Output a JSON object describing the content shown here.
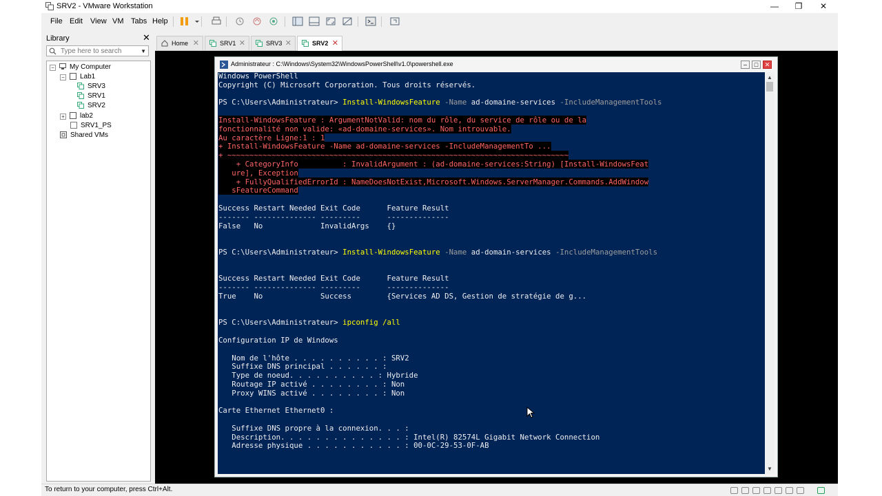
{
  "window": {
    "title": "SRV2 - VMware Workstation"
  },
  "menu": [
    "File",
    "Edit",
    "View",
    "VM",
    "Tabs",
    "Help"
  ],
  "library": {
    "header": "Library",
    "search_placeholder": "Type here to search",
    "tree": [
      "My Computer",
      "Lab1",
      "SRV3",
      "SRV1",
      "SRV2",
      "lab2",
      "SRV1_PS",
      "Shared VMs"
    ]
  },
  "tabs": [
    {
      "label": "Home"
    },
    {
      "label": "SRV1"
    },
    {
      "label": "SRV3"
    },
    {
      "label": "SRV2",
      "active": true
    }
  ],
  "powershell": {
    "title": "Administrateur : C:\\Windows\\System32\\WindowsPowerShell\\v1.0\\powershell.exe",
    "header": [
      "Windows PowerShell",
      "Copyright (C) Microsoft Corporation. Tous droits réservés."
    ],
    "prompt": "PS C:\\Users\\Administrateur>",
    "cmd1": {
      "name": "Install-WindowsFeature",
      "param": "-Name",
      "value": "ad-domaine-services",
      "switch": "-IncludeManagementTools"
    },
    "error_lines": [
      "Install-WindowsFeature : ArgumentNotValid: nom du rôle, du service de rôle ou de la",
      "fonctionnalité non valide: «ad-domaine-services». Nom introuvable.",
      "Au caractère Ligne:1 : 1",
      "+ Install-WindowsFeature -Name ad-domaine-services -IncludeManagementTo ...",
      "+ ~~~~~~~~~~~~~~~~~~~~~~~~~~~~~~~~~~~~~~~~~~~~~~~~~~~~~~~~~~~~~~~~~~~~~~~~~~~~~",
      "    + CategoryInfo          : InvalidArgument : (ad-domaine-services:String) [Install-WindowsFeat",
      "   ure], Exception",
      "    + FullyQualifiedErrorId : NameDoesNotExist,Microsoft.Windows.ServerManager.Commands.AddWindow",
      "   sFeatureCommand"
    ],
    "result_header": "Success Restart Needed Exit Code      Feature Result",
    "result_rule": "------- -------------- ---------      --------------",
    "result1": "False   No             InvalidArgs    {}",
    "cmd2": {
      "name": "Install-WindowsFeature",
      "param": "-Name",
      "value": "ad-domain-services",
      "switch": "-IncludeManagementTools"
    },
    "result2": "True    No             Success        {Services AD DS, Gestion de stratégie de g...",
    "cmd3": "ipconfig /all",
    "ipconfig": [
      "Configuration IP de Windows",
      "",
      "   Nom de l'hôte . . . . . . . . . . : SRV2",
      "   Suffixe DNS principal . . . . . . :",
      "   Type de noeud. . . . . . . . . . : Hybride",
      "   Routage IP activé . . . . . . . . : Non",
      "   Proxy WINS activé . . . . . . . . : Non",
      "",
      "Carte Ethernet Ethernet0 :",
      "",
      "   Suffixe DNS propre à la connexion. . . :",
      "   Description. . . . . . . . . . . . . . : Intel(R) 82574L Gigabit Network Connection",
      "   Adresse physique . . . . . . . . . . . : 00-0C-29-53-0F-AB"
    ]
  },
  "status": {
    "text": "To return to your computer, press Ctrl+Alt."
  }
}
